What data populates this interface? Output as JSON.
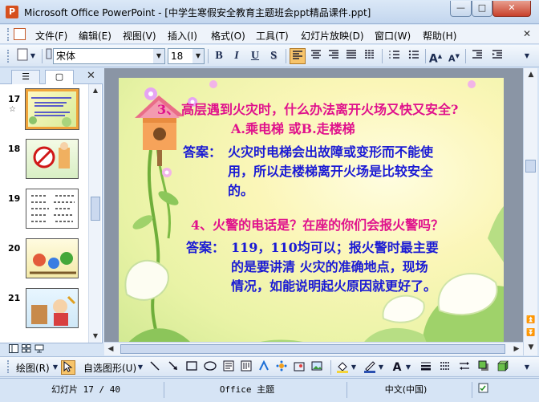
{
  "window": {
    "app_icon": "P",
    "title": "Microsoft Office PowerPoint - [中学生寒假安全教育主题班会ppt精品课件.ppt]",
    "minimize": "—",
    "maximize": "□",
    "close": "✕"
  },
  "menu": {
    "items": [
      "文件(F)",
      "编辑(E)",
      "视图(V)",
      "插入(I)",
      "格式(O)",
      "工具(T)",
      "幻灯片放映(D)",
      "窗口(W)",
      "帮助(H)"
    ],
    "close_doc": "✕"
  },
  "toolbar": {
    "font_name": "宋体",
    "font_size": "18",
    "bold": "B",
    "italic": "I",
    "underline": "U",
    "shadow": "S",
    "grow_font": "A",
    "shrink_font": "A"
  },
  "left_panel": {
    "tab_outline": "☰",
    "tab_slides": "▢",
    "close": "✕",
    "slides": [
      {
        "number": "17",
        "marker": "☆"
      },
      {
        "number": "18",
        "marker": ""
      },
      {
        "number": "19",
        "marker": ""
      },
      {
        "number": "20",
        "marker": ""
      },
      {
        "number": "21",
        "marker": ""
      }
    ]
  },
  "slide": {
    "q3_number": "3、",
    "q3": "高层遇到火灾时，什么办法离开火场又快又安全?",
    "q3_options": "A.乘电梯 或B.走楼梯",
    "a3_label": "答案：",
    "a3_line1": "火灾时电梯会出故障或变形而不能使",
    "a3_line2": "用，所以走楼梯离开火场是比较安全",
    "a3_line3": "的。",
    "q4": "4、火警的电话是？在座的你们会报火警吗？",
    "a4_label": "答案：",
    "a4_line1": "119，110均可以；报火警时最主要",
    "a4_line2": "的是要讲清 火灾的准确地点，现场",
    "a4_line3": "情况，如能说明起火原因就更好了。"
  },
  "draw_toolbar": {
    "draw_menu": "绘图(R)",
    "autoshape_menu": "自选图形(U)"
  },
  "status": {
    "slide_position": "幻灯片 17 / 40",
    "design": "Office 主题",
    "language": "中文(中国)"
  },
  "colors": {
    "question": "#e0118c",
    "answer": "#1a1ad4"
  }
}
